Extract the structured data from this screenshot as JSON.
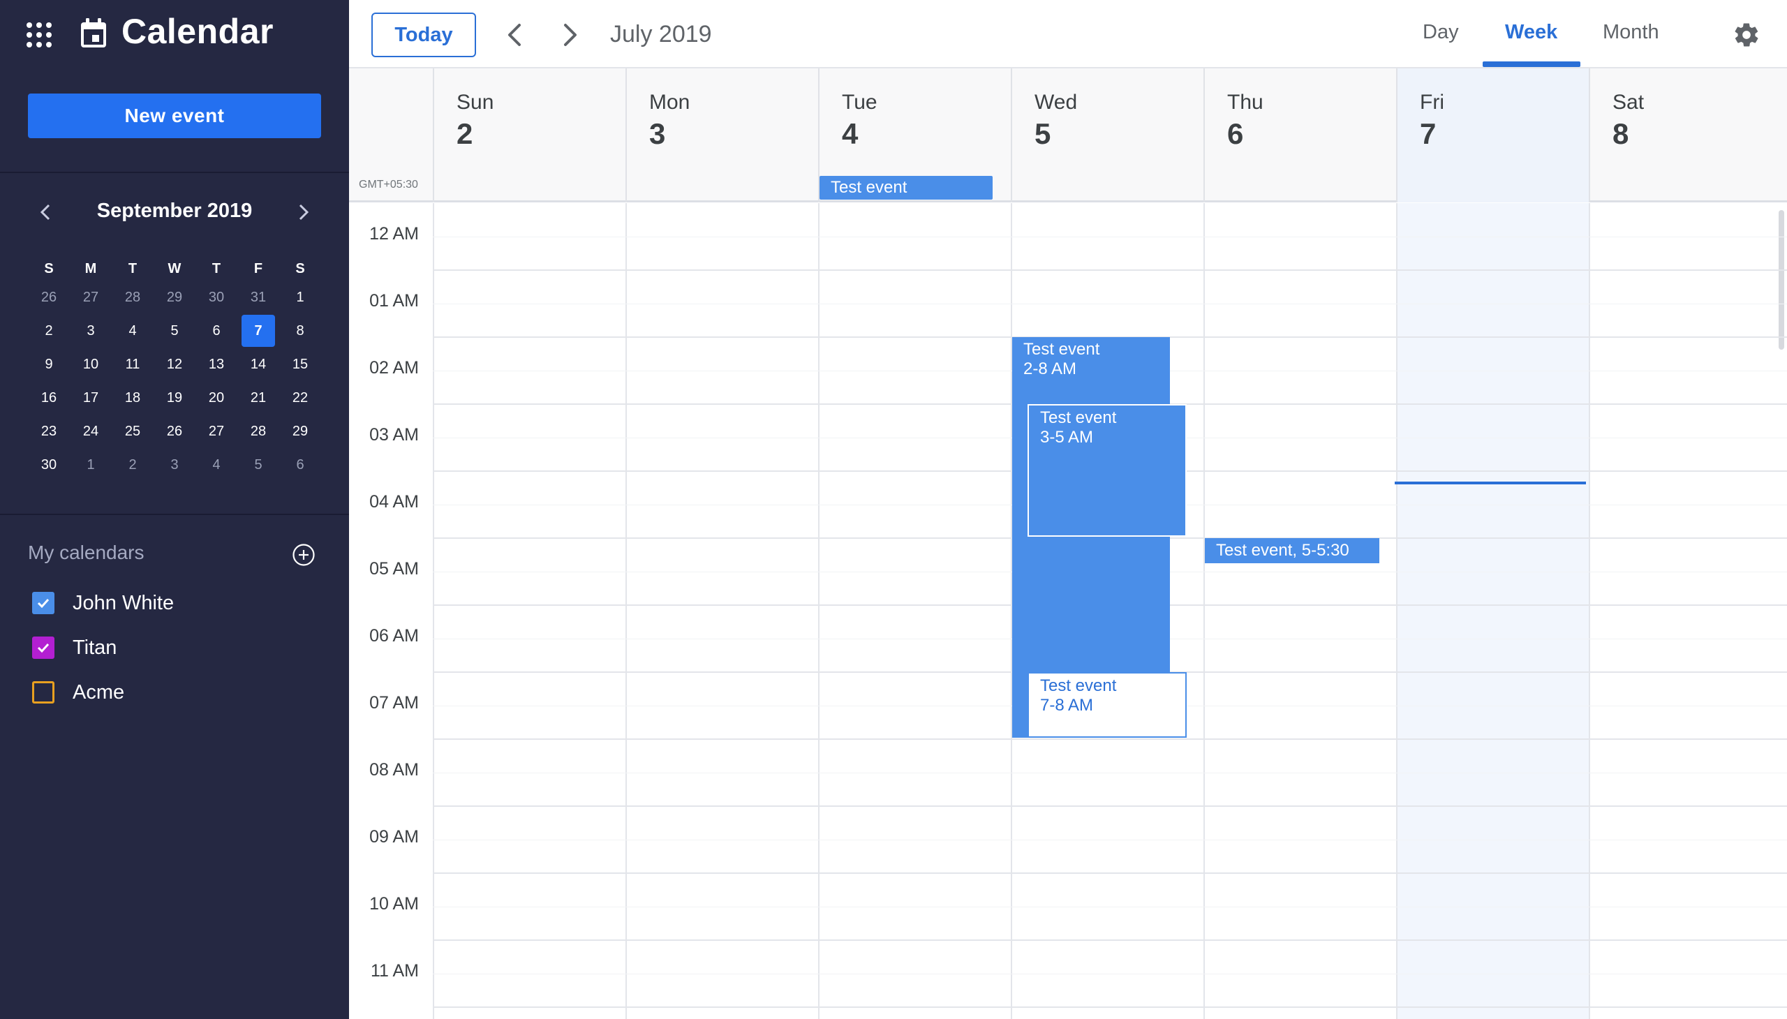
{
  "app": {
    "title": "Calendar"
  },
  "sidebar": {
    "new_event_label": "New event",
    "mini_calendar": {
      "month_label": "September 2019",
      "dow": [
        "S",
        "M",
        "T",
        "W",
        "T",
        "F",
        "S"
      ],
      "days": [
        {
          "d": "26",
          "other": true
        },
        {
          "d": "27",
          "other": true
        },
        {
          "d": "28",
          "other": true
        },
        {
          "d": "29",
          "other": true
        },
        {
          "d": "30",
          "other": true
        },
        {
          "d": "31",
          "other": true
        },
        {
          "d": "1"
        },
        {
          "d": "2"
        },
        {
          "d": "3"
        },
        {
          "d": "4"
        },
        {
          "d": "5"
        },
        {
          "d": "6"
        },
        {
          "d": "7",
          "today": true
        },
        {
          "d": "8"
        },
        {
          "d": "9"
        },
        {
          "d": "10"
        },
        {
          "d": "11"
        },
        {
          "d": "12"
        },
        {
          "d": "13"
        },
        {
          "d": "14"
        },
        {
          "d": "15"
        },
        {
          "d": "16"
        },
        {
          "d": "17"
        },
        {
          "d": "18"
        },
        {
          "d": "19"
        },
        {
          "d": "20"
        },
        {
          "d": "21"
        },
        {
          "d": "22"
        },
        {
          "d": "23"
        },
        {
          "d": "24"
        },
        {
          "d": "25"
        },
        {
          "d": "26"
        },
        {
          "d": "27"
        },
        {
          "d": "28"
        },
        {
          "d": "29"
        },
        {
          "d": "30"
        },
        {
          "d": "1",
          "other": true
        },
        {
          "d": "2",
          "other": true
        },
        {
          "d": "3",
          "other": true
        },
        {
          "d": "4",
          "other": true
        },
        {
          "d": "5",
          "other": true
        },
        {
          "d": "6",
          "other": true
        }
      ]
    },
    "my_calendars": {
      "title": "My calendars",
      "items": [
        {
          "label": "John White",
          "color": "#4a8ee8",
          "checked": true
        },
        {
          "label": "Titan",
          "color": "#b31fd1",
          "checked": true
        },
        {
          "label": "Acme",
          "color": "#e8a020",
          "checked": false
        }
      ]
    }
  },
  "toolbar": {
    "today_label": "Today",
    "title": "July 2019",
    "views": [
      {
        "label": "Day",
        "active": false
      },
      {
        "label": "Week",
        "active": true
      },
      {
        "label": "Month",
        "active": false
      }
    ]
  },
  "week": {
    "timezone": "GMT+05:30",
    "days": [
      {
        "name": "Sun",
        "num": "2"
      },
      {
        "name": "Mon",
        "num": "3"
      },
      {
        "name": "Tue",
        "num": "4"
      },
      {
        "name": "Wed",
        "num": "5"
      },
      {
        "name": "Thu",
        "num": "6"
      },
      {
        "name": "Fri",
        "num": "7",
        "today": true
      },
      {
        "name": "Sat",
        "num": "8"
      }
    ],
    "all_day_events": [
      {
        "day_index": 2,
        "title": "Test event"
      }
    ],
    "hours": [
      "12 AM",
      "01 AM",
      "02 AM",
      "03 AM",
      "04 AM",
      "05 AM",
      "06 AM",
      "07 AM",
      "08 AM",
      "09 AM",
      "10 AM",
      "11 AM"
    ],
    "events": [
      {
        "day_index": 3,
        "title": "Test event",
        "time": "2-8 AM",
        "start": 2,
        "end": 8,
        "style": "filled",
        "lane": "a"
      },
      {
        "day_index": 3,
        "title": "Test event",
        "time": "3-5 AM",
        "start": 3,
        "end": 5,
        "style": "outlined",
        "lane": "b"
      },
      {
        "day_index": 3,
        "title": "Test event",
        "time": "7-8 AM",
        "start": 7,
        "end": 8,
        "style": "white",
        "lane": "b"
      },
      {
        "day_index": 4,
        "title": "Test event, 5-5:30",
        "time": "",
        "start": 5,
        "end": 5.4,
        "style": "filled",
        "lane": "single"
      }
    ]
  },
  "colors": {
    "accent": "#2470f0",
    "event": "#4a8ee8",
    "sidebar_bg": "#252842"
  }
}
